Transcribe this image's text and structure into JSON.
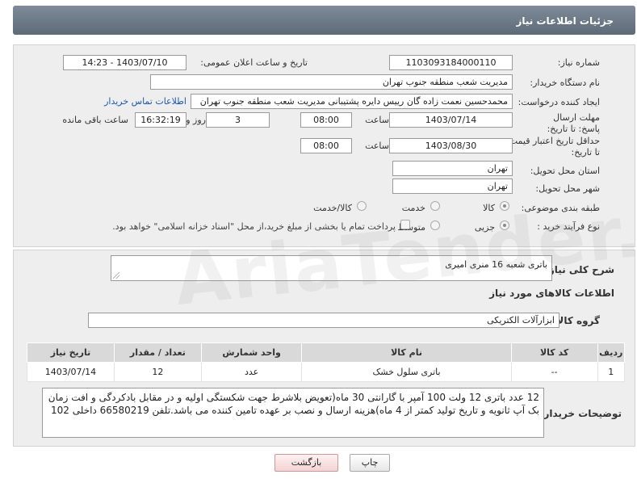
{
  "header": {
    "title": "جزئیات اطلاعات نیاز"
  },
  "fields": {
    "need_number_label": "شماره نیاز:",
    "need_number": "1103093184000110",
    "announce_label": "تاریخ و ساعت اعلان عمومی:",
    "announce_value": "1403/07/10 - 14:23",
    "buyer_org_label": "نام دستگاه خریدار:",
    "buyer_org": "مدیریت شعب منطقه جنوب تهران",
    "creator_label": "ایجاد کننده درخواست:",
    "creator": "محمدحسین نعمت زاده گان رییس دایره پشتیبانی مدیریت شعب منطقه جنوب تهران",
    "contact_link": "اطلاعات تماس خریدار",
    "deadline_label": "مهلت ارسال پاسخ: تا تاریخ:",
    "deadline_date": "1403/07/14",
    "time_label": "ساعت",
    "deadline_time": "08:00",
    "days_count": "3",
    "days_label": "روز و",
    "remaining_time": "16:32:19",
    "remaining_label": "ساعت باقی مانده",
    "validity_label": "حداقل تاریخ اعتبار قیمت: تا تاریخ:",
    "validity_date": "1403/08/30",
    "validity_time": "08:00",
    "province_label": "استان محل تحویل:",
    "province": "تهران",
    "city_label": "شهر محل تحویل:",
    "city": "تهران",
    "category_label": "طبقه بندی موضوعی:",
    "category_options": [
      "کالا",
      "خدمت",
      "کالا/خدمت"
    ],
    "process_label": "نوع فرآیند خرید :",
    "process_options": [
      "جزیی",
      "متوسط"
    ],
    "payment_note": "پرداخت تمام یا بخشی از مبلغ خرید،از محل \"اسناد خزانه اسلامی\" خواهد بود."
  },
  "summary": {
    "label": "شرح کلی نیاز:",
    "value": "باتری شعبه 16 منری امیری"
  },
  "goods_section": {
    "title": "اطلاعات کالاهای مورد نیاز",
    "group_label": "گروه کالا:",
    "group_value": "ابزارآلات الکتریکی"
  },
  "table": {
    "headers": [
      "ردیف",
      "کد کالا",
      "نام کالا",
      "واحد شمارش",
      "تعداد / مقدار",
      "تاریخ نیاز"
    ],
    "rows": [
      [
        "1",
        "--",
        "باتری سلول خشک",
        "عدد",
        "12",
        "1403/07/14"
      ]
    ]
  },
  "buyer_notes": {
    "label": "توضیحات خریدار:",
    "text": "12 عدد باتری 12 ولت 100 آمپر با گارانتی 30 ماه(تعویض بلاشرط جهت شکستگی اولیه و در مقابل بادکردگی و افت زمان بک آپ ثانویه و تاریخ تولید کمتر از 4 ماه)هزینه ارسال و نصب بر عهده تامین کننده می باشد.تلفن 66580219 داخلی 102"
  },
  "buttons": {
    "print": "چاپ",
    "back": "بازگشت"
  },
  "watermark": "AriaTender.neT"
}
